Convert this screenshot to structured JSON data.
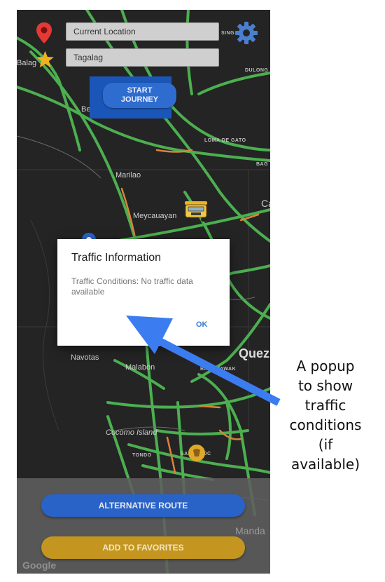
{
  "search": {
    "origin_value": "Current Location",
    "destination_value": "Tagalag"
  },
  "start_button": {
    "line1": "START",
    "line2": "JOURNEY"
  },
  "map": {
    "labels": {
      "balag": "Balag",
      "sing": "SING",
      "dulong": "DULONG",
      "be": "Be",
      "loma_de_gato": "LOMA DE GATO",
      "bag": "BAG",
      "marilao": "Marilao",
      "ca": "Ca",
      "meycauayan": "Meycauayan",
      "navotas": "Navotas",
      "malabon": "Malabon",
      "quez": "Quez",
      "balintawak": "BALINTAWAK",
      "cocomo_island": "Cocomo Island",
      "tondo": "TONDO",
      "sampaloc": "SAMPALOC",
      "manda": "Manda"
    },
    "icons": {
      "origin": "location-pin-icon",
      "destination": "star-icon",
      "settings": "gear-icon",
      "vehicle": "jeepney-icon",
      "user_location": "user-location-icon"
    },
    "colors": {
      "traffic_clear": "#4caf50",
      "traffic_moderate": "#d9843b",
      "pin": "#e53935",
      "star": "#f2b01e"
    }
  },
  "dialog": {
    "title": "Traffic Information",
    "message": "Traffic Conditions: No traffic data available",
    "ok_label": "OK"
  },
  "actions": {
    "alternative_route": "ALTERNATIVE ROUTE",
    "add_to_favorites": "ADD TO FAVORITES"
  },
  "attribution": "Google",
  "annotation": {
    "lines": [
      "A popup",
      "to show",
      "traffic",
      "conditions",
      "(if",
      "available)"
    ]
  }
}
